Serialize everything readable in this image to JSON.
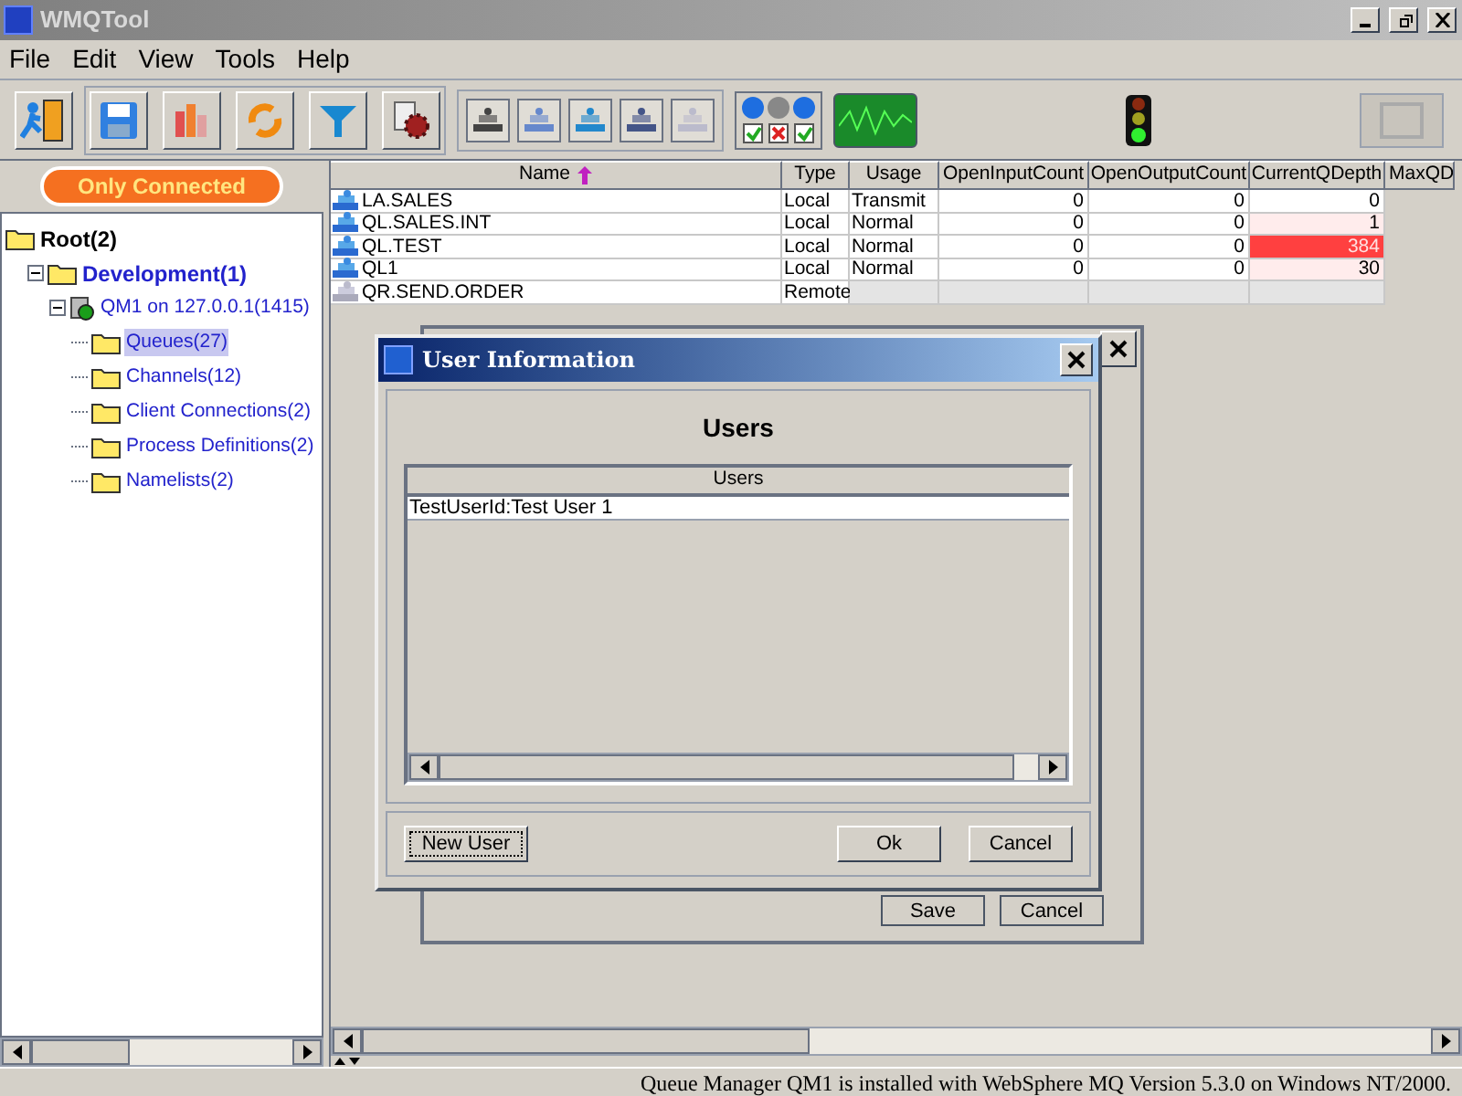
{
  "window": {
    "title": "WMQTool"
  },
  "menu": [
    "File",
    "Edit",
    "View",
    "Tools",
    "Help"
  ],
  "filter_button": "Only Connected",
  "tree": [
    {
      "label": "Root(2)",
      "kind": "folder",
      "selected": false,
      "children": [
        {
          "label": "Development(1)",
          "kind": "folder",
          "selected": false,
          "children": [
            {
              "label": "QM1  on 127.0.0.1(1415)",
              "kind": "qmgr",
              "selected": false,
              "children": [
                {
                  "label": "Queues(27)",
                  "kind": "folder",
                  "selected": true
                },
                {
                  "label": "Channels(12)",
                  "kind": "folder",
                  "selected": false
                },
                {
                  "label": "Client Connections(2)",
                  "kind": "folder",
                  "selected": false
                },
                {
                  "label": "Process Definitions(2)",
                  "kind": "folder",
                  "selected": false
                },
                {
                  "label": "Namelists(2)",
                  "kind": "folder",
                  "selected": false
                }
              ]
            }
          ]
        }
      ]
    }
  ],
  "table": {
    "columns": [
      "Name",
      "Type",
      "Usage",
      "OpenInputCount",
      "OpenOutputCount",
      "CurrentQDepth",
      "MaxQD"
    ],
    "rows": [
      {
        "kind": "local",
        "color": "#ffffff",
        "cells": [
          "LA.SALES",
          "Local",
          "Transmit",
          "0",
          "0",
          "0"
        ]
      },
      {
        "kind": "local",
        "color": "#ffecec",
        "cells": [
          "QL.SALES.INT",
          "Local",
          "Normal",
          "0",
          "0",
          "1"
        ]
      },
      {
        "kind": "local",
        "color": "#ff4040",
        "cells": [
          "QL.TEST",
          "Local",
          "Normal",
          "0",
          "0",
          "384"
        ]
      },
      {
        "kind": "local",
        "color": "#ffecec",
        "cells": [
          "QL1",
          "Local",
          "Normal",
          "0",
          "0",
          "30"
        ]
      },
      {
        "kind": "remote",
        "color": "#e4e4e4",
        "cells": [
          "QR.SEND.ORDER",
          "Remote"
        ]
      }
    ]
  },
  "back_dialog": {
    "buttons": [
      "Save",
      "Cancel"
    ]
  },
  "dialog": {
    "title": "User Information",
    "heading": "Users",
    "list_header": "Users",
    "items": [
      "TestUserId:Test User 1"
    ],
    "buttons": [
      "New User",
      "Ok",
      "Cancel"
    ]
  },
  "status_bar": "Queue Manager QM1  is installed with WebSphere MQ Version 5.3.0 on Windows NT/2000."
}
